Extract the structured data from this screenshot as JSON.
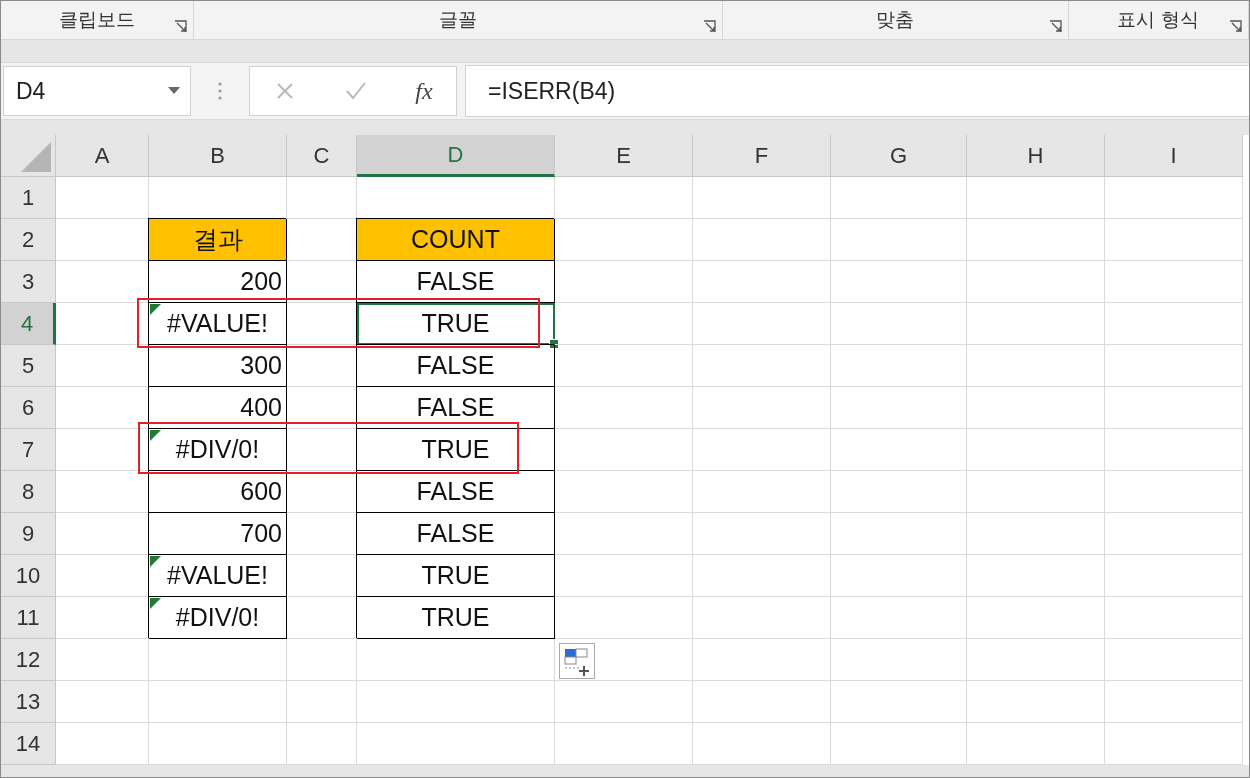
{
  "ribbon_groups": [
    {
      "label": "클립보드",
      "launcher": true
    },
    {
      "label": "글꼴",
      "launcher": true
    },
    {
      "label": "맞춤",
      "launcher": true
    },
    {
      "label": "표시 형식",
      "launcher": true
    }
  ],
  "formula_bar": {
    "name_box": "D4",
    "function_button": "fx",
    "formula": "=ISERR(B4)"
  },
  "columns": [
    {
      "label": "A",
      "selected": false
    },
    {
      "label": "B",
      "selected": false
    },
    {
      "label": "C",
      "selected": false
    },
    {
      "label": "D",
      "selected": true
    },
    {
      "label": "E",
      "selected": false
    },
    {
      "label": "F",
      "selected": false
    },
    {
      "label": "G",
      "selected": false
    },
    {
      "label": "H",
      "selected": false
    },
    {
      "label": "I",
      "selected": false
    }
  ],
  "rows": [
    {
      "header": "1",
      "selected": false,
      "cells": [
        {
          "kind": "empty"
        },
        {
          "kind": "empty"
        },
        {
          "kind": "empty"
        },
        {
          "kind": "empty"
        },
        {
          "kind": "empty"
        },
        {
          "kind": "empty"
        },
        {
          "kind": "empty"
        },
        {
          "kind": "empty"
        },
        {
          "kind": "empty"
        }
      ]
    },
    {
      "header": "2",
      "selected": false,
      "cells": [
        {
          "kind": "empty"
        },
        {
          "kind": "heading",
          "text": "결과",
          "error_flag": false,
          "selected": false
        },
        {
          "kind": "empty"
        },
        {
          "kind": "heading",
          "text": "COUNT",
          "error_flag": false,
          "selected": false
        },
        {
          "kind": "empty"
        },
        {
          "kind": "empty"
        },
        {
          "kind": "empty"
        },
        {
          "kind": "empty"
        },
        {
          "kind": "empty"
        }
      ]
    },
    {
      "header": "3",
      "selected": false,
      "cells": [
        {
          "kind": "empty"
        },
        {
          "kind": "number",
          "text": "200",
          "error_flag": false,
          "selected": false
        },
        {
          "kind": "empty"
        },
        {
          "kind": "logical",
          "text": "FALSE",
          "error_flag": false,
          "selected": false
        },
        {
          "kind": "empty"
        },
        {
          "kind": "empty"
        },
        {
          "kind": "empty"
        },
        {
          "kind": "empty"
        },
        {
          "kind": "empty"
        }
      ]
    },
    {
      "header": "4",
      "selected": true,
      "cells": [
        {
          "kind": "empty"
        },
        {
          "kind": "error",
          "text": "#VALUE!",
          "error_flag": true,
          "selected": false
        },
        {
          "kind": "empty"
        },
        {
          "kind": "logical",
          "text": "TRUE",
          "error_flag": false,
          "selected": true
        },
        {
          "kind": "empty"
        },
        {
          "kind": "empty"
        },
        {
          "kind": "empty"
        },
        {
          "kind": "empty"
        },
        {
          "kind": "empty"
        }
      ]
    },
    {
      "header": "5",
      "selected": false,
      "cells": [
        {
          "kind": "empty"
        },
        {
          "kind": "number",
          "text": "300",
          "error_flag": false,
          "selected": false
        },
        {
          "kind": "empty"
        },
        {
          "kind": "logical",
          "text": "FALSE",
          "error_flag": false,
          "selected": false
        },
        {
          "kind": "empty"
        },
        {
          "kind": "empty"
        },
        {
          "kind": "empty"
        },
        {
          "kind": "empty"
        },
        {
          "kind": "empty"
        }
      ]
    },
    {
      "header": "6",
      "selected": false,
      "cells": [
        {
          "kind": "empty"
        },
        {
          "kind": "number",
          "text": "400",
          "error_flag": false,
          "selected": false
        },
        {
          "kind": "empty"
        },
        {
          "kind": "logical",
          "text": "FALSE",
          "error_flag": false,
          "selected": false
        },
        {
          "kind": "empty"
        },
        {
          "kind": "empty"
        },
        {
          "kind": "empty"
        },
        {
          "kind": "empty"
        },
        {
          "kind": "empty"
        }
      ]
    },
    {
      "header": "7",
      "selected": false,
      "cells": [
        {
          "kind": "empty"
        },
        {
          "kind": "error",
          "text": "#DIV/0!",
          "error_flag": true,
          "selected": false
        },
        {
          "kind": "empty"
        },
        {
          "kind": "logical",
          "text": "TRUE",
          "error_flag": false,
          "selected": false
        },
        {
          "kind": "empty"
        },
        {
          "kind": "empty"
        },
        {
          "kind": "empty"
        },
        {
          "kind": "empty"
        },
        {
          "kind": "empty"
        }
      ]
    },
    {
      "header": "8",
      "selected": false,
      "cells": [
        {
          "kind": "empty"
        },
        {
          "kind": "number",
          "text": "600",
          "error_flag": false,
          "selected": false
        },
        {
          "kind": "empty"
        },
        {
          "kind": "logical",
          "text": "FALSE",
          "error_flag": false,
          "selected": false
        },
        {
          "kind": "empty"
        },
        {
          "kind": "empty"
        },
        {
          "kind": "empty"
        },
        {
          "kind": "empty"
        },
        {
          "kind": "empty"
        }
      ]
    },
    {
      "header": "9",
      "selected": false,
      "cells": [
        {
          "kind": "empty"
        },
        {
          "kind": "number",
          "text": "700",
          "error_flag": false,
          "selected": false
        },
        {
          "kind": "empty"
        },
        {
          "kind": "logical",
          "text": "FALSE",
          "error_flag": false,
          "selected": false
        },
        {
          "kind": "empty"
        },
        {
          "kind": "empty"
        },
        {
          "kind": "empty"
        },
        {
          "kind": "empty"
        },
        {
          "kind": "empty"
        }
      ]
    },
    {
      "header": "10",
      "selected": false,
      "cells": [
        {
          "kind": "empty"
        },
        {
          "kind": "error",
          "text": "#VALUE!",
          "error_flag": true,
          "selected": false
        },
        {
          "kind": "empty"
        },
        {
          "kind": "logical",
          "text": "TRUE",
          "error_flag": false,
          "selected": false
        },
        {
          "kind": "empty"
        },
        {
          "kind": "empty"
        },
        {
          "kind": "empty"
        },
        {
          "kind": "empty"
        },
        {
          "kind": "empty"
        }
      ]
    },
    {
      "header": "11",
      "selected": false,
      "cells": [
        {
          "kind": "empty"
        },
        {
          "kind": "error",
          "text": "#DIV/0!",
          "error_flag": true,
          "selected": false
        },
        {
          "kind": "empty"
        },
        {
          "kind": "logical",
          "text": "TRUE",
          "error_flag": false,
          "selected": false
        },
        {
          "kind": "empty"
        },
        {
          "kind": "empty"
        },
        {
          "kind": "empty"
        },
        {
          "kind": "empty"
        },
        {
          "kind": "empty"
        }
      ]
    },
    {
      "header": "12",
      "selected": false,
      "cells": [
        {
          "kind": "empty"
        },
        {
          "kind": "empty"
        },
        {
          "kind": "empty"
        },
        {
          "kind": "empty"
        },
        {
          "kind": "empty"
        },
        {
          "kind": "empty"
        },
        {
          "kind": "empty"
        },
        {
          "kind": "empty"
        },
        {
          "kind": "empty"
        }
      ]
    },
    {
      "header": "13",
      "selected": false,
      "cells": [
        {
          "kind": "empty"
        },
        {
          "kind": "empty"
        },
        {
          "kind": "empty"
        },
        {
          "kind": "empty"
        },
        {
          "kind": "empty"
        },
        {
          "kind": "empty"
        },
        {
          "kind": "empty"
        },
        {
          "kind": "empty"
        },
        {
          "kind": "empty"
        }
      ]
    },
    {
      "header": "14",
      "selected": false,
      "cells": [
        {
          "kind": "empty"
        },
        {
          "kind": "empty"
        },
        {
          "kind": "empty"
        },
        {
          "kind": "empty"
        },
        {
          "kind": "empty"
        },
        {
          "kind": "empty"
        },
        {
          "kind": "empty"
        },
        {
          "kind": "empty"
        },
        {
          "kind": "empty"
        }
      ]
    }
  ]
}
